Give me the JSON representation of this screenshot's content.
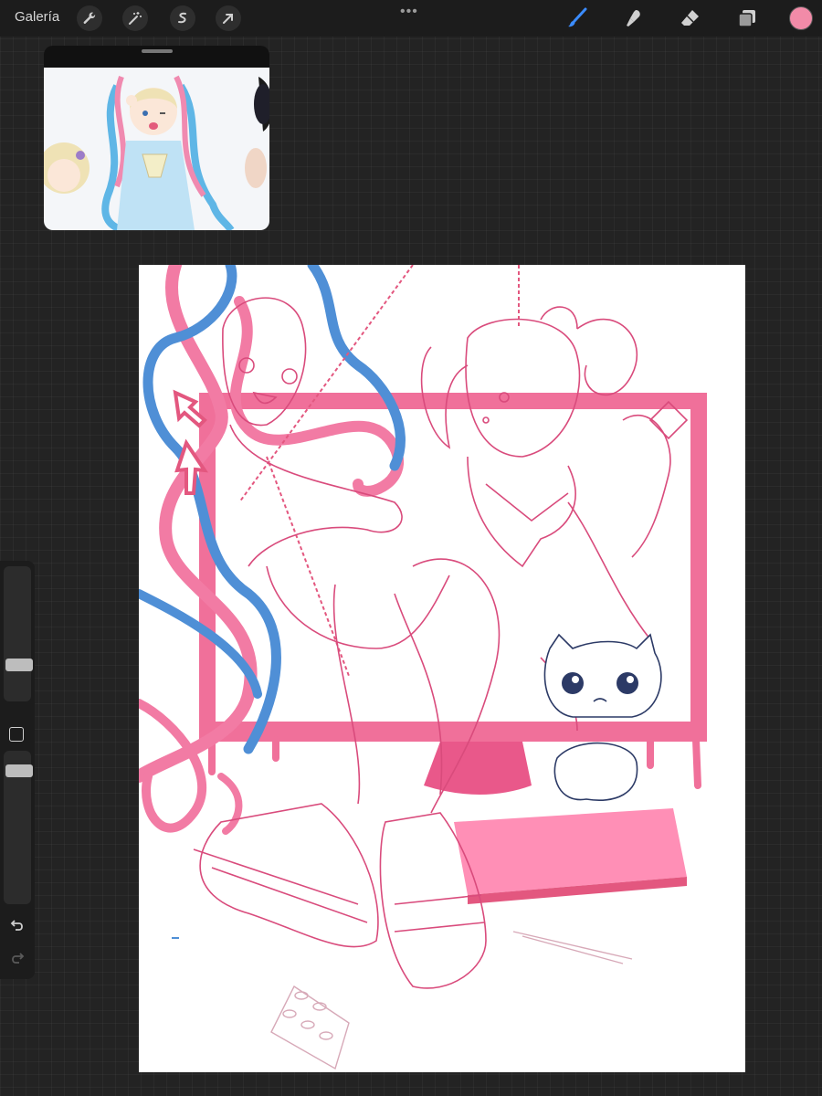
{
  "app": {
    "gallery_label": "Galería"
  },
  "toolbar": {
    "left_tools": [
      "wrench-icon",
      "magic-wand-icon",
      "selection-icon",
      "transform-arrow-icon"
    ],
    "right_tools": [
      "brush-icon",
      "smudge-icon",
      "eraser-icon",
      "layers-icon"
    ],
    "active_tool": "brush-icon",
    "active_tool_color": "#3b8cff",
    "current_color": "#f28ba8"
  },
  "reference_window": {
    "visible": true
  },
  "sidebar": {
    "brush_size_level": 0.25,
    "opacity_level": 0.1
  },
  "colors": {
    "pink_lineart": "#d94b7c",
    "pink_fill": "#f0709a",
    "blue_hair": "#4f8fd6",
    "dark_lineart": "#2c3a66"
  }
}
